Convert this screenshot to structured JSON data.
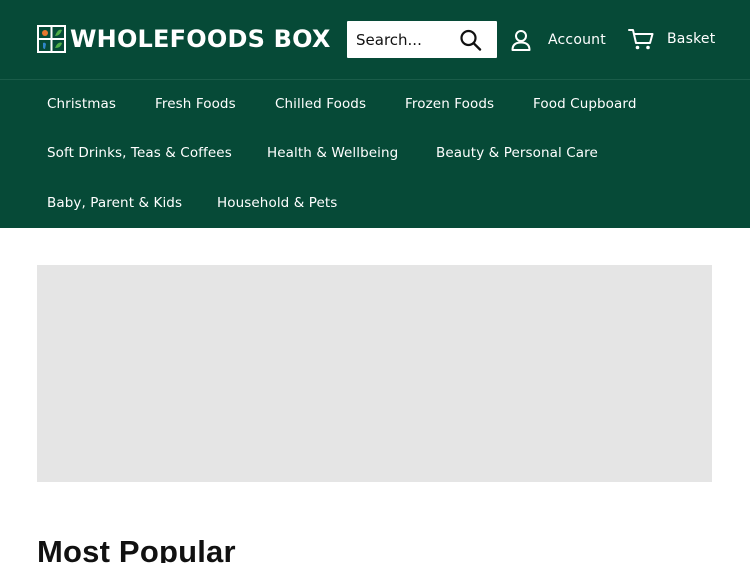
{
  "header": {
    "logo_text": "WHOLEFOODS BOX",
    "search": {
      "placeholder": "Search..."
    },
    "account_label": "Account",
    "basket_label": "Basket"
  },
  "nav": {
    "items": [
      "Christmas",
      "Fresh Foods",
      "Chilled Foods",
      "Frozen Foods",
      "Food Cupboard",
      "Soft Drinks, Teas & Coffees",
      "Health & Wellbeing",
      "Beauty & Personal Care",
      "Baby, Parent & Kids",
      "Household & Pets"
    ]
  },
  "main": {
    "section_title": "Most Popular"
  },
  "colors": {
    "header_bg": "#064a37",
    "banner_placeholder": "#e5e5e5",
    "logo_orange": "#e8772e",
    "logo_green": "#4fae47",
    "logo_blue": "#2f86c8"
  },
  "icons": [
    "logo-mark-icon",
    "search-icon",
    "account-icon",
    "basket-icon"
  ]
}
